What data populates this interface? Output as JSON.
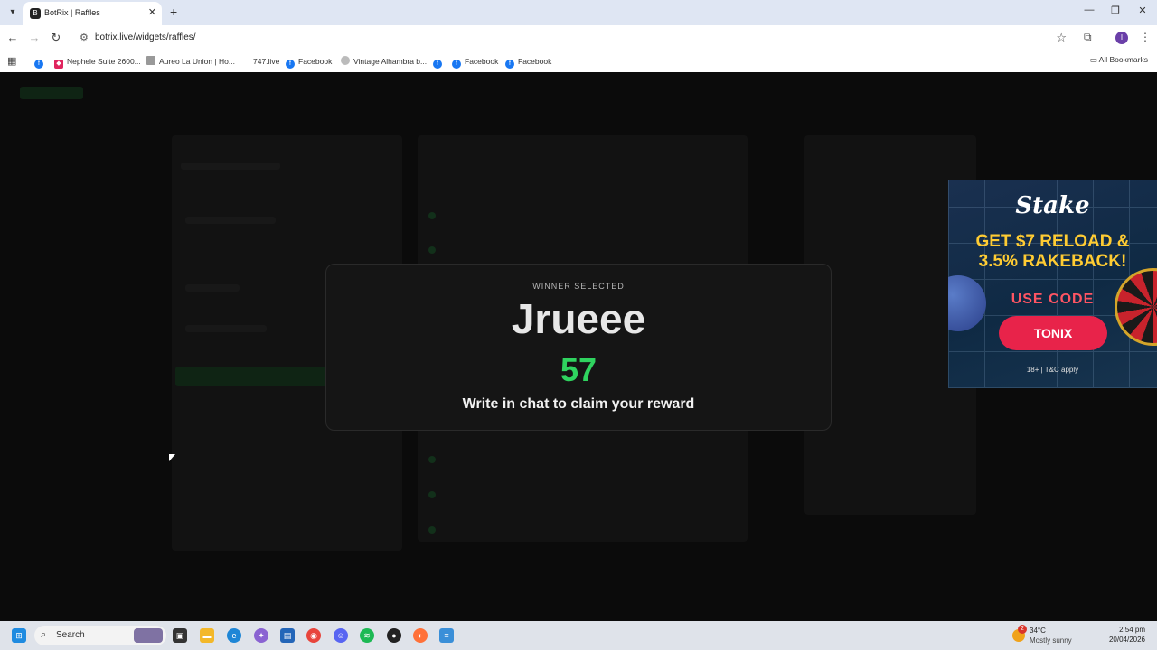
{
  "browser": {
    "tab_title": "BotRix | Raffles",
    "url": "botrix.live/widgets/raffles/",
    "bookmarks": [
      "Nephele Suite 2600...",
      "Aureo La Union | Ho...",
      "747.live",
      "Facebook",
      "Vintage Alhambra b...",
      "Facebook",
      "Facebook"
    ],
    "all_bookmarks": "All Bookmarks",
    "profile_initial": "I"
  },
  "modal": {
    "label": "WINNER SELECTED",
    "winner": "Jrueee",
    "number": "57",
    "message": "Write in chat to claim your reward"
  },
  "ad": {
    "brand": "Stake",
    "headline_line1": "GET $7 RELOAD &",
    "headline_line2": "3.5% RAKEBACK!",
    "use_code": "USE CODE",
    "code": "TONIX",
    "terms": "18+ | T&C apply"
  },
  "taskbar": {
    "search_placeholder": "Search",
    "temperature": "34°C",
    "condition": "Mostly sunny",
    "weather_badge": "2",
    "time": "2:54 pm",
    "date": "20/04/2026"
  },
  "colors": {
    "winner_number": "#2fd35f",
    "ad_headline": "#ffcc33",
    "ad_button": "#e8234a"
  }
}
